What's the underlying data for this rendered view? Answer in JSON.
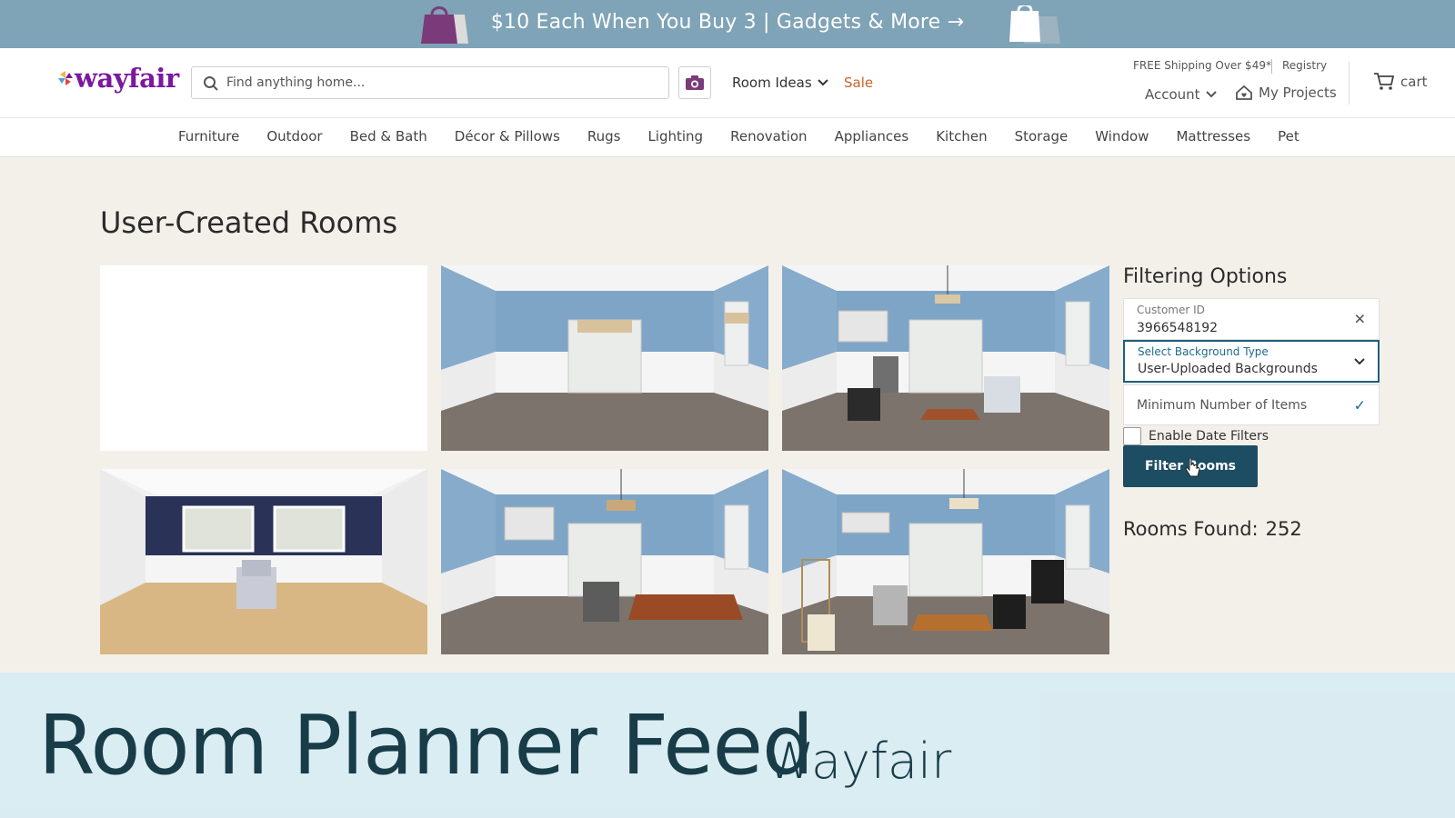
{
  "promo": {
    "text": "$10 Each When You Buy 3 | Gadgets & More →",
    "colors": {
      "bar": "#7fa3b7",
      "bag_purple": "#7b3b7a"
    }
  },
  "header": {
    "logo_text": "wayfair",
    "brand_color": "#7b189f",
    "search_placeholder": "Find anything home...",
    "room_ideas": "Room Ideas",
    "sale": "Sale",
    "free_shipping": "FREE Shipping Over $49*",
    "registry": "Registry",
    "account": "Account",
    "my_projects": "My Projects",
    "cart": "cart"
  },
  "nav": {
    "items": [
      "Furniture",
      "Outdoor",
      "Bed & Bath",
      "Décor & Pillows",
      "Rugs",
      "Lighting",
      "Renovation",
      "Appliances",
      "Kitchen",
      "Storage",
      "Window",
      "Mattresses",
      "Pet"
    ]
  },
  "main": {
    "title": "User-Created Rooms",
    "rooms": [
      {
        "scene": "blank"
      },
      {
        "scene": "empty-blue-room"
      },
      {
        "scene": "blue-room-chairs-table-rug"
      },
      {
        "scene": "navy-wall-room-chair"
      },
      {
        "scene": "blue-room-chair-rug"
      },
      {
        "scene": "blue-room-black-chairs-rug"
      }
    ]
  },
  "filters": {
    "title": "Filtering Options",
    "customer_id_label": "Customer ID",
    "customer_id_value": "3966548192",
    "background_label": "Select Background Type",
    "background_value": "User-Uploaded Backgrounds",
    "min_items_label": "Minimum Number of Items",
    "date_filters_label": "Enable Date Filters",
    "filter_button": "Filter Rooms",
    "rooms_found_label": "Rooms Found:",
    "rooms_found_value": "252",
    "accent_color": "#1d4d63"
  },
  "caption": {
    "title": "Room Planner Feed",
    "subtitle": "Wayfair"
  }
}
